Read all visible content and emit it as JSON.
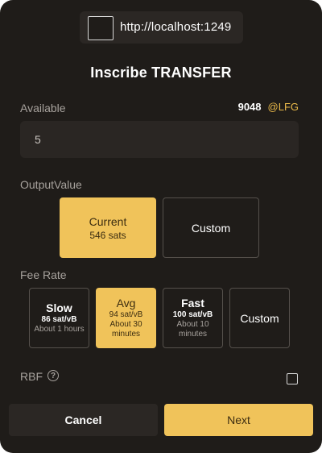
{
  "origin": {
    "url": "http://localhost:1249"
  },
  "title": "Inscribe TRANSFER",
  "available": {
    "label": "Available",
    "amount": "9048",
    "ticker": "@LFG"
  },
  "amount_input": {
    "value": "5"
  },
  "output_value": {
    "label": "OutputValue",
    "current": {
      "title": "Current",
      "sub": "546 sats",
      "selected": true
    },
    "custom": {
      "title": "Custom"
    }
  },
  "fee_rate": {
    "label": "Fee Rate",
    "options": [
      {
        "name": "Slow",
        "rate": "86 sat/vB",
        "time": "About 1 hours"
      },
      {
        "name": "Avg",
        "rate": "94 sat/vB",
        "time": "About 30 minutes",
        "selected": true
      },
      {
        "name": "Fast",
        "rate": "100 sat/vB",
        "time": "About 10 minutes"
      },
      {
        "name": "Custom"
      }
    ]
  },
  "rbf": {
    "label": "RBF",
    "help_glyph": "?",
    "checked": false
  },
  "actions": {
    "cancel": "Cancel",
    "next": "Next"
  },
  "colors": {
    "accent": "#f0c35a",
    "background": "#1f1c19",
    "ticker": "#e9b949"
  }
}
